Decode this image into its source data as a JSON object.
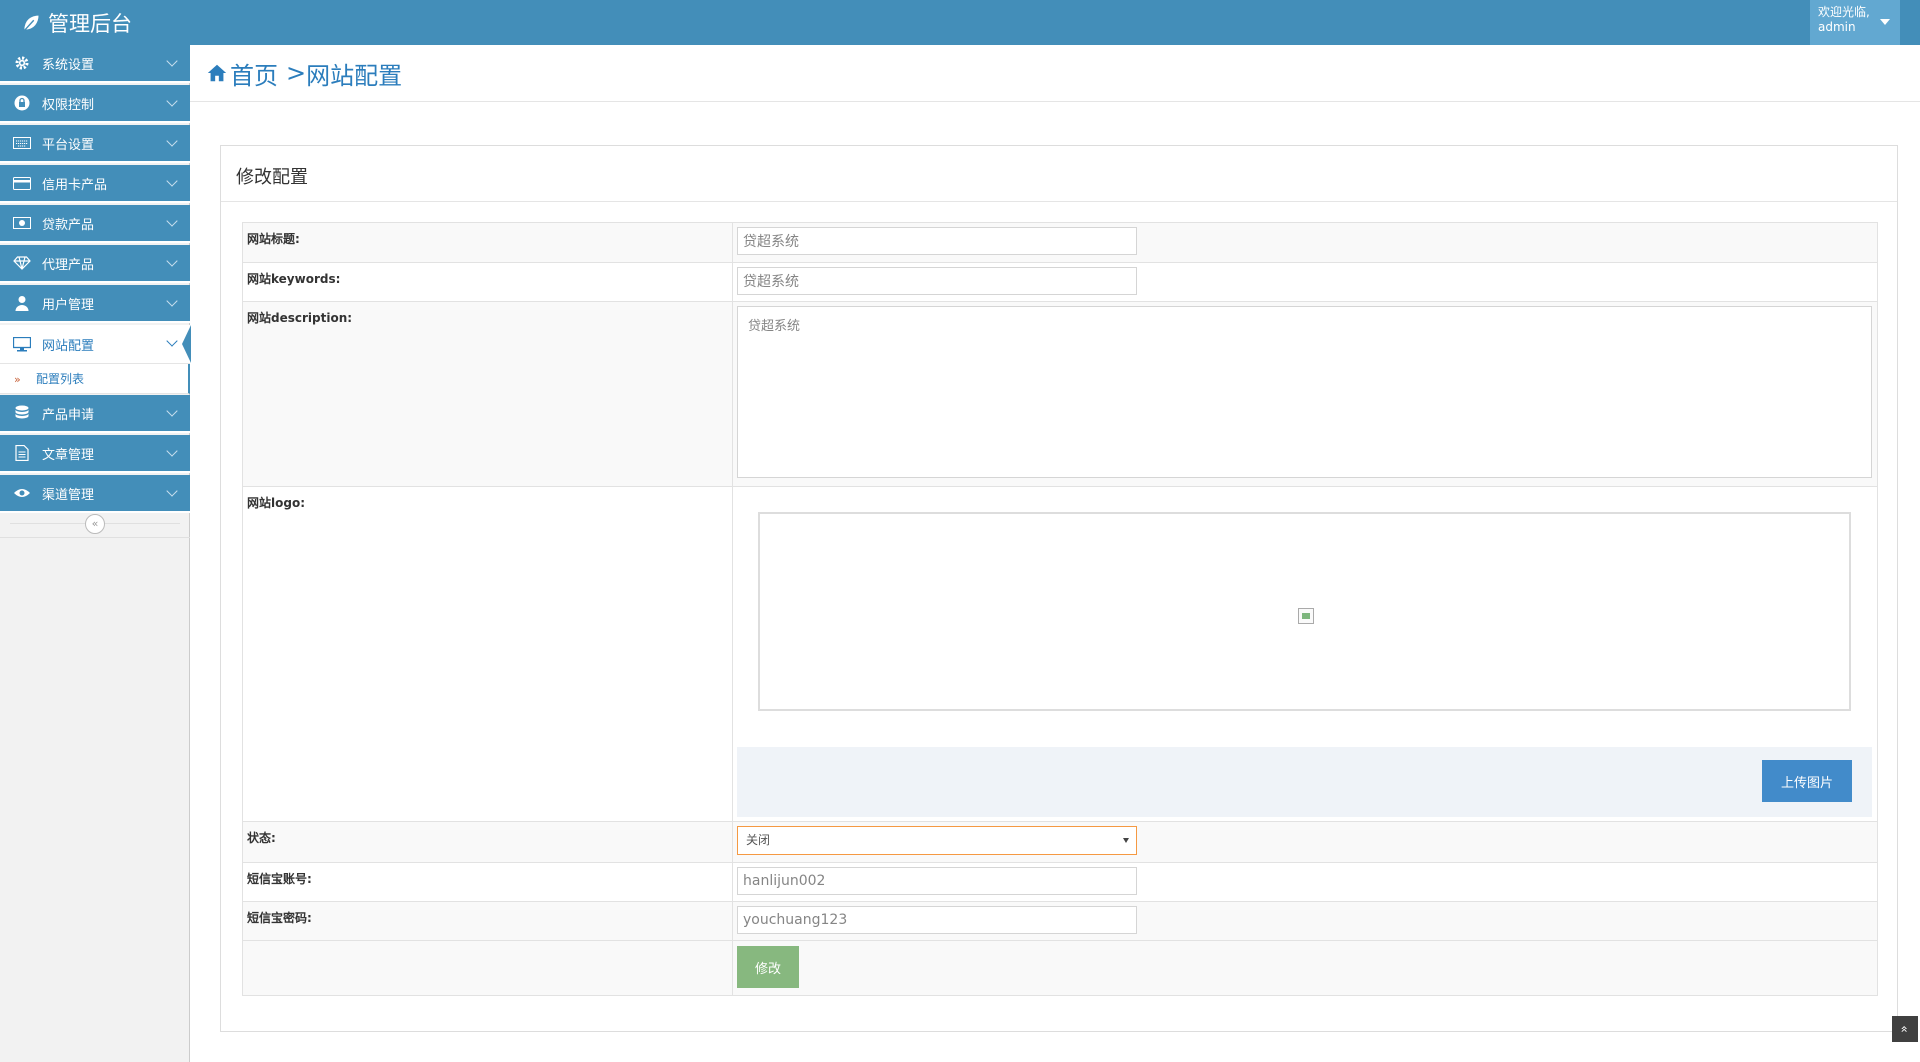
{
  "navbar": {
    "brand": "管理后台",
    "user_greeting": "欢迎光临,",
    "user_name": "admin",
    "color": "#438eb9"
  },
  "sidebar": {
    "items": [
      {
        "label": "系统设置",
        "icon": "gear-icon"
      },
      {
        "label": "权限控制",
        "icon": "lock-icon"
      },
      {
        "label": "平台设置",
        "icon": "keyboard-icon"
      },
      {
        "label": "信用卡产品",
        "icon": "credit-card-icon"
      },
      {
        "label": "贷款产品",
        "icon": "money-icon"
      },
      {
        "label": "代理产品",
        "icon": "diamond-icon"
      },
      {
        "label": "用户管理",
        "icon": "user-icon"
      },
      {
        "label": "网站配置",
        "icon": "desktop-icon",
        "active": true
      },
      {
        "label": "产品申请",
        "icon": "database-icon"
      },
      {
        "label": "文章管理",
        "icon": "file-icon"
      },
      {
        "label": "渠道管理",
        "icon": "eye-icon"
      }
    ],
    "submenu_item": "配置列表",
    "collapse_glyph": "«"
  },
  "breadcrumb": {
    "home": "首页",
    "separator": ">",
    "current": "网站配置"
  },
  "panel": {
    "title": "修改配置"
  },
  "form": {
    "title_label": "网站标题:",
    "title_value": "贷超系统",
    "keywords_label": "网站keywords:",
    "keywords_value": "贷超系统",
    "description_label": "网站description:",
    "description_value": "贷超系统",
    "logo_label": "网站logo:",
    "upload_button": "上传图片",
    "status_label": "状态:",
    "status_value": "关闭",
    "sms_account_label": "短信宝账号:",
    "sms_account_value": "hanlijun002",
    "sms_password_label": "短信宝密码:",
    "sms_password_value": "youchuang123",
    "submit_button": "修改"
  },
  "scroll_top_glyph": "«"
}
